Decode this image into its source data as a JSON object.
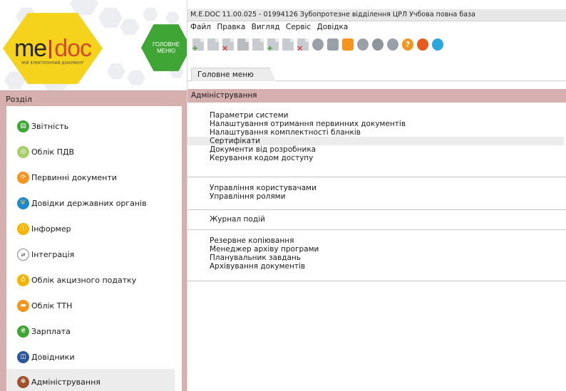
{
  "app": {
    "title": "M.E.DOC 11.00.025  - 01994126 Зубопротезне відділення ЦРЛ Учбова повна база",
    "logo": {
      "text_left": "me",
      "text_right": "doc",
      "tagline": "МІЙ ЕЛЕКТРОННИЙ ДОКУМЕНТ"
    },
    "main_menu_button": {
      "line1": "ГОЛОВНЕ",
      "line2": "МЕНЮ"
    }
  },
  "menu": [
    "Файл",
    "Правка",
    "Вигляд",
    "Сервіс",
    "Довідка"
  ],
  "toolbar": {
    "icons": [
      "new-report-icon",
      "open-report-icon",
      "delete-report-icon",
      "document-icon",
      "edit-document-icon",
      "add-document-icon",
      "search-document-icon",
      "remove-document-icon",
      "sign-icon",
      "print-icon",
      "send-icon",
      "key-icon",
      "receive-icon",
      "check-icon",
      "help-icon",
      "chat-icon",
      "messenger-icon"
    ]
  },
  "tab": {
    "label": "Головне меню"
  },
  "sidebar": {
    "header": "Розділ",
    "items": [
      {
        "label": "Звітність",
        "icon": "report-icon",
        "color": "#3fa535"
      },
      {
        "label": "Облік ПДВ",
        "icon": "vat-icon",
        "color": "#8cc63f"
      },
      {
        "label": "Первинні документи",
        "icon": "primary-documents-icon",
        "color": "#f7941d"
      },
      {
        "label": "Довідки державних органів",
        "icon": "state-agencies-icon",
        "color": "#1e88d2"
      },
      {
        "label": "Інформер",
        "icon": "informer-icon",
        "color": "#f5b400"
      },
      {
        "label": "Інтеграція",
        "icon": "integration-icon",
        "color": "#ffffff"
      },
      {
        "label": "Облік акцизного податку",
        "icon": "excise-icon",
        "color": "#f5b400"
      },
      {
        "label": "Облік ТТН",
        "icon": "ttn-icon",
        "color": "#f7941d"
      },
      {
        "label": "Зарплата",
        "icon": "salary-icon",
        "color": "#3fa535"
      },
      {
        "label": "Довідники",
        "icon": "directories-icon",
        "color": "#2b579a"
      },
      {
        "label": "Адміністрування",
        "icon": "administration-icon",
        "color": "#a0522d"
      }
    ]
  },
  "content": {
    "header": "Адміністрування",
    "groups": [
      [
        "Параметри системи",
        "Налаштування отримання первинних документів",
        "Налаштування комплектності бланків",
        "Сертифікати",
        "Документи від розробника",
        "Керування кодом доступу"
      ],
      [
        "Управління користувачами",
        "Управління ролями"
      ],
      [
        "Журнал подій"
      ],
      [
        "Резервне копіювання",
        "Менеджер архіву програми",
        "Планувальник завдань",
        "Архівування документів"
      ]
    ]
  }
}
